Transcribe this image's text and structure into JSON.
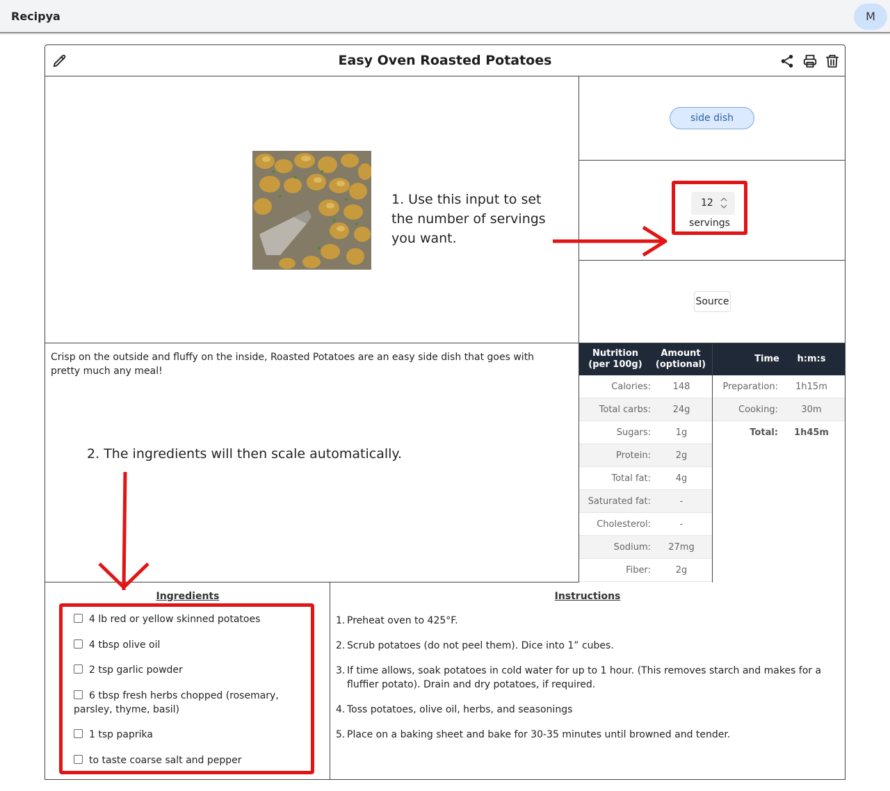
{
  "app": {
    "brand": "Recipya",
    "avatar_initial": "M"
  },
  "recipe": {
    "title": "Easy Oven Roasted Potatoes",
    "category_tag": "side dish",
    "servings_value": "12",
    "servings_label": "servings",
    "source_label": "Source",
    "description": "Crisp on the outside and fluffy on the inside, Roasted Potatoes are an easy side dish that goes with pretty much any meal!"
  },
  "annotations": {
    "note1": "1. Use this input to set the number of servings you want.",
    "note2": "2. The ingredients will then scale automatically.",
    "arrow_color": "#e11515"
  },
  "nutrition": {
    "header_col1": "Nutrition (per 100g)",
    "header_col2": "Amount (optional)",
    "rows": [
      {
        "label": "Calories:",
        "value": "148"
      },
      {
        "label": "Total carbs:",
        "value": "24g"
      },
      {
        "label": "Sugars:",
        "value": "1g"
      },
      {
        "label": "Protein:",
        "value": "2g"
      },
      {
        "label": "Total fat:",
        "value": "4g"
      },
      {
        "label": "Saturated fat:",
        "value": "-"
      },
      {
        "label": "Cholesterol:",
        "value": "-"
      },
      {
        "label": "Sodium:",
        "value": "27mg"
      },
      {
        "label": "Fiber:",
        "value": "2g"
      }
    ]
  },
  "times": {
    "header_col1": "Time",
    "header_col2": "h:m:s",
    "rows": [
      {
        "label": "Preparation:",
        "value": "1h15m"
      },
      {
        "label": "Cooking:",
        "value": "30m"
      },
      {
        "label": "Total:",
        "value": "1h45m"
      }
    ]
  },
  "ingredients": {
    "heading": "Ingredients",
    "items": [
      "4 lb red or yellow skinned potatoes",
      "4 tbsp olive oil",
      "2 tsp garlic powder",
      "6 tbsp fresh herbs chopped (rosemary, parsley, thyme, basil)",
      "1 tsp paprika",
      "to taste coarse salt and pepper"
    ]
  },
  "instructions": {
    "heading": "Instructions",
    "steps": [
      {
        "num": "1.",
        "text": "Preheat oven to 425°F."
      },
      {
        "num": "2.",
        "text": "Scrub potatoes (do not peel them). Dice into 1” cubes."
      },
      {
        "num": "3.",
        "text": "If time allows, soak potatoes in cold water for up to 1 hour. (This removes starch and makes for a fluffier potato). Drain and dry potatoes, if required."
      },
      {
        "num": "4.",
        "text": "Toss potatoes, olive oil, herbs, and seasonings"
      },
      {
        "num": "5.",
        "text": "Place on a baking sheet and bake for 30-35 minutes until browned and tender."
      }
    ]
  },
  "icons": {
    "edit": "pencil-icon",
    "share": "share-icon",
    "print": "printer-icon",
    "delete": "trash-icon"
  }
}
